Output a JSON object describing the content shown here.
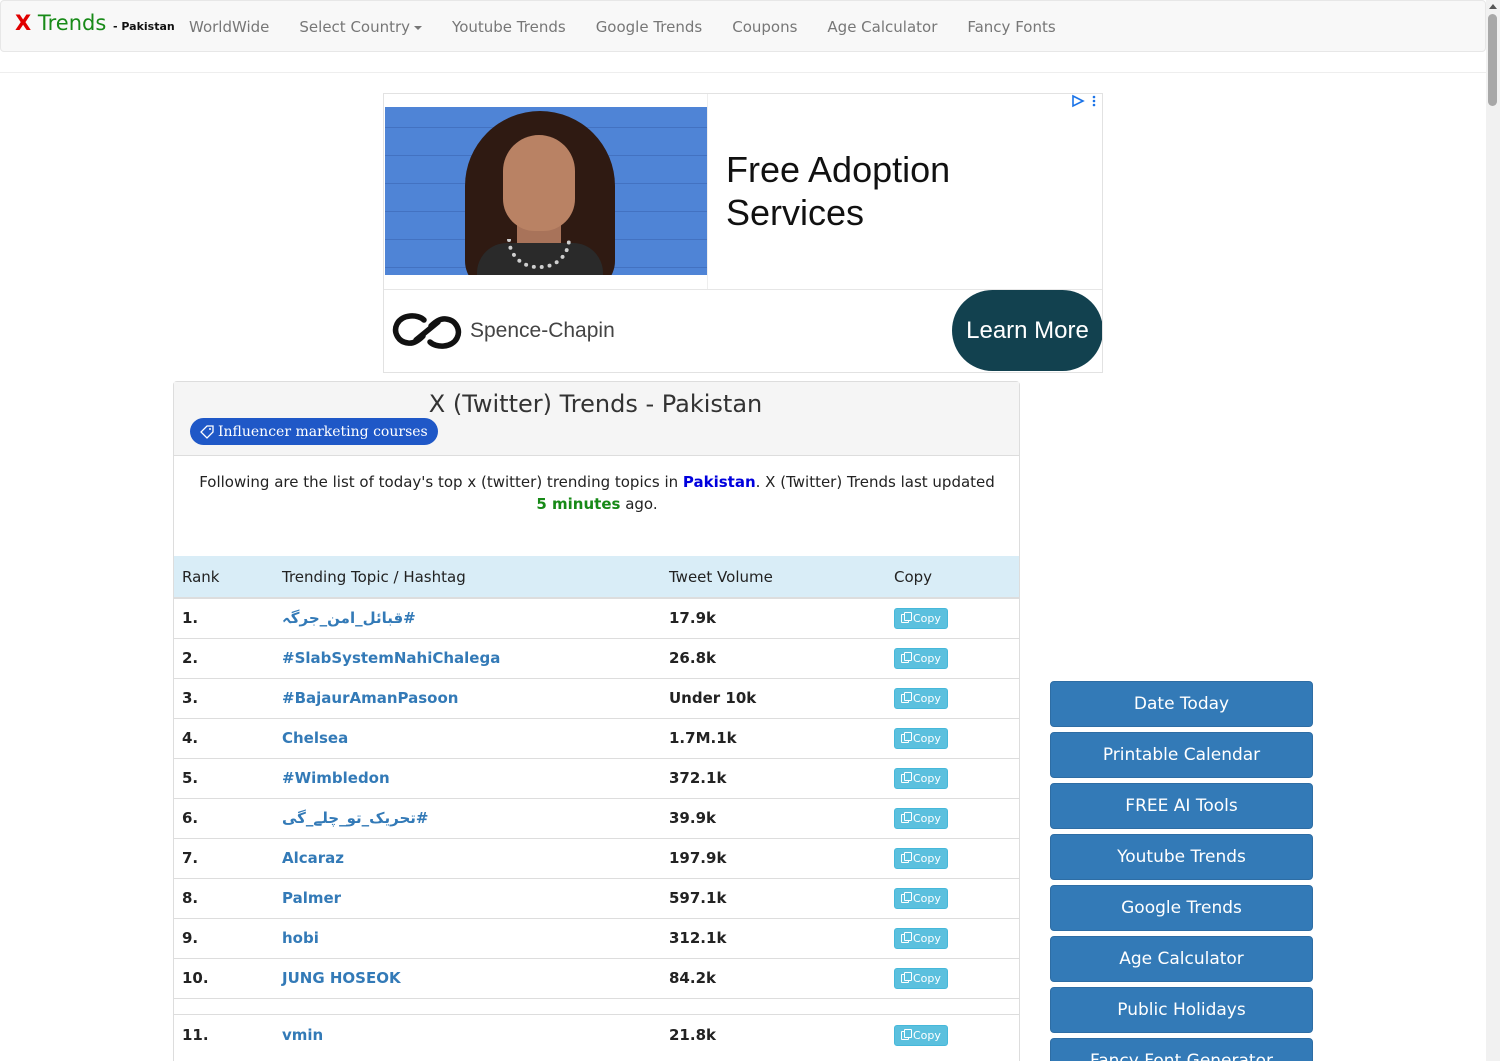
{
  "brand": {
    "x": "X",
    "trends": "Trends",
    "country": "- Pakistan"
  },
  "nav": {
    "worldwide": "WorldWide",
    "select_country": "Select Country",
    "youtube": "Youtube Trends",
    "google": "Google Trends",
    "coupons": "Coupons",
    "age": "Age Calculator",
    "fancy": "Fancy Fonts"
  },
  "ad": {
    "headline_line1": "Free Adoption",
    "headline_line2": "Services",
    "advertiser": "Spence-Chapin",
    "cta": "Learn More",
    "choices_icon": "adchoices-icon"
  },
  "panel": {
    "title": "X (Twitter) Trends - Pakistan",
    "tag_button": "Influencer marketing courses",
    "intro_pre": "Following are the list of today's top x (twitter) trending topics in ",
    "intro_country": "Pakistan",
    "intro_mid": ". X (Twitter) Trends last updated ",
    "intro_updated": "5 minutes",
    "intro_post": " ago."
  },
  "table": {
    "headers": [
      "Rank",
      "Trending Topic / Hashtag",
      "Tweet Volume",
      "Copy"
    ],
    "copy_label": "Copy",
    "rows": [
      {
        "rank": "1.",
        "topic": "#قبائل_امن_جرگہ",
        "volume": "17.9k"
      },
      {
        "rank": "2.",
        "topic": "#SlabSystemNahiChalega",
        "volume": "26.8k"
      },
      {
        "rank": "3.",
        "topic": "#BajaurAmanPasoon",
        "volume": "Under 10k"
      },
      {
        "rank": "4.",
        "topic": "Chelsea",
        "volume": "1.7M.1k"
      },
      {
        "rank": "5.",
        "topic": "#Wimbledon",
        "volume": "372.1k"
      },
      {
        "rank": "6.",
        "topic": "#تحریک_تو_چلے_گی",
        "volume": "39.9k"
      },
      {
        "rank": "7.",
        "topic": "Alcaraz",
        "volume": "197.9k"
      },
      {
        "rank": "8.",
        "topic": "Palmer",
        "volume": "597.1k"
      },
      {
        "rank": "9.",
        "topic": "hobi",
        "volume": "312.1k"
      },
      {
        "rank": "10.",
        "topic": "JUNG HOSEOK",
        "volume": "84.2k"
      },
      {
        "rank": "11.",
        "topic": "vmin",
        "volume": "21.8k"
      }
    ]
  },
  "sidebar": {
    "items": [
      "Date Today",
      "Printable Calendar",
      "FREE AI Tools",
      "Youtube Trends",
      "Google Trends",
      "Age Calculator",
      "Public Holidays",
      "Fancy Font Generator"
    ]
  }
}
